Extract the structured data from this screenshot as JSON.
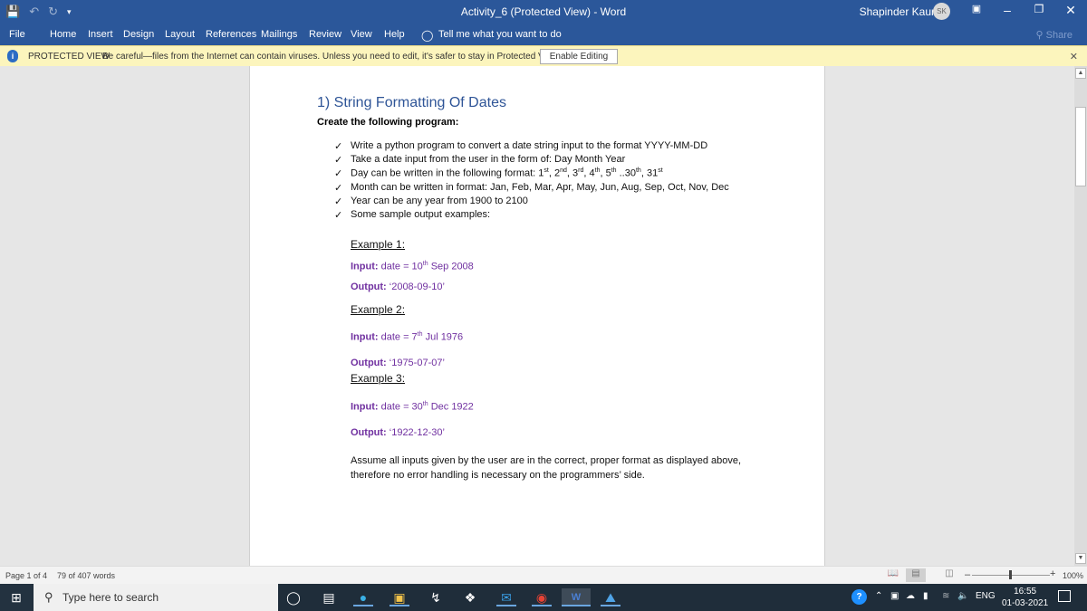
{
  "titlebar": {
    "title": "Activity_6 (Protected View)  -  Word",
    "user_name": "Shapinder Kaur",
    "user_initials": "SK",
    "qat": {
      "save": "save-icon",
      "undo": "undo-icon",
      "redo": "redo-icon",
      "customize": "customize-icon"
    }
  },
  "ribbon": {
    "tabs": [
      "File",
      "Home",
      "Insert",
      "Design",
      "Layout",
      "References",
      "Mailings",
      "Review",
      "View",
      "Help"
    ],
    "tell_me": "Tell me what you want to do",
    "share": "Share"
  },
  "protected_view": {
    "label": "PROTECTED VIEW",
    "message": "Be careful—files from the Internet can contain viruses. Unless you need to edit, it's safer to stay in Protected View.",
    "enable_button": "Enable Editing"
  },
  "document": {
    "heading": "1) String Formatting Of Dates",
    "subheading": "Create the following program:",
    "bullets": [
      "Write a python program to convert a date string input to the format YYYY-MM-DD",
      "Take a date input from the user in the form of: Day Month Year",
      "Day can be written in the following format: 1st, 2nd, 3rd, 4th, 5th ..30th, 31st",
      "Month can be written in format: Jan, Feb, Mar, Apr, May, Jun, Aug, Sep, Oct, Nov, Dec",
      "Year can be any year from 1900 to 2100",
      "Some sample output examples:"
    ],
    "examples": [
      {
        "title": "Example 1:",
        "input_label": "Input:",
        "input_pre": " date = 10",
        "input_sup": "th",
        "input_post": " Sep 2008",
        "output_label": "Output:",
        "output_value": " ‘2008-09-10’"
      },
      {
        "title": "Example 2:",
        "input_label": "Input:",
        "input_pre": " date = 7",
        "input_sup": "th",
        "input_post": " Jul 1976",
        "output_label": "Output:",
        "output_value": " ‘1975-07-07’"
      },
      {
        "title": "Example 3:",
        "input_label": "Input:",
        "input_pre": " date = 30",
        "input_sup": "th",
        "input_post": " Dec 1922",
        "output_label": "Output:",
        "output_value": " ‘1922-12-30’"
      }
    ],
    "closing": "Assume all inputs given by the user are in the correct, proper format as displayed above, therefore no error handling is necessary on the programmers’ side."
  },
  "statusbar": {
    "page": "Page 1 of 4",
    "words": "79 of 407 words",
    "zoom": "100%",
    "zoom_level_percent": 100
  },
  "taskbar": {
    "search_placeholder": "Type here to search",
    "language": "ENG",
    "time": "16:55",
    "date": "01-03-2021"
  },
  "colors": {
    "accent": "#2b579a",
    "protected_bar": "#fcf5bd",
    "heading": "#2f5597",
    "example_text": "#7030a0"
  }
}
